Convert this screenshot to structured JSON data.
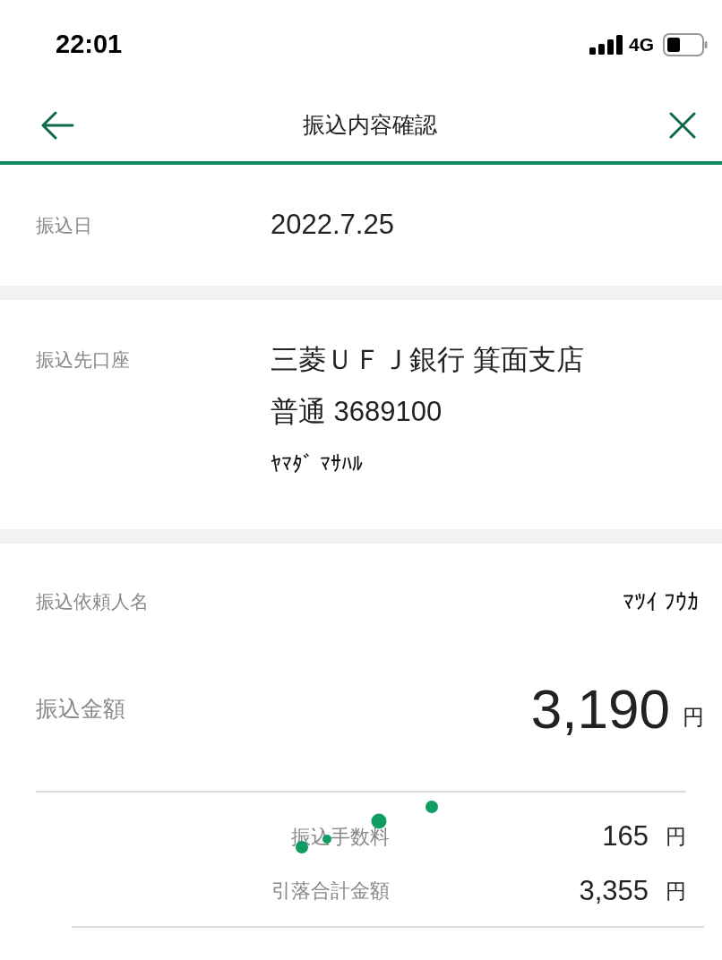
{
  "status_bar": {
    "time": "22:01",
    "network": "4G"
  },
  "header": {
    "title": "振込内容確認"
  },
  "transfer_date": {
    "label": "振込日",
    "value": "2022.7.25"
  },
  "destination": {
    "label": "振込先口座",
    "lines": [
      "三菱ＵＦＪ銀行 箕面支店",
      "普通 3689100",
      "ﾔﾏﾀﾞ ﾏｻﾊﾙ"
    ]
  },
  "requester": {
    "label": "振込依頼人名",
    "value": "ﾏﾂｲ ﾌｳｶ"
  },
  "amount": {
    "label": "振込金額",
    "value": "3,190",
    "unit": "円"
  },
  "charges": [
    {
      "label": "振込手数料",
      "value": "165",
      "unit": "円"
    },
    {
      "label": "引落合計金額",
      "value": "3,355",
      "unit": "円"
    }
  ]
}
